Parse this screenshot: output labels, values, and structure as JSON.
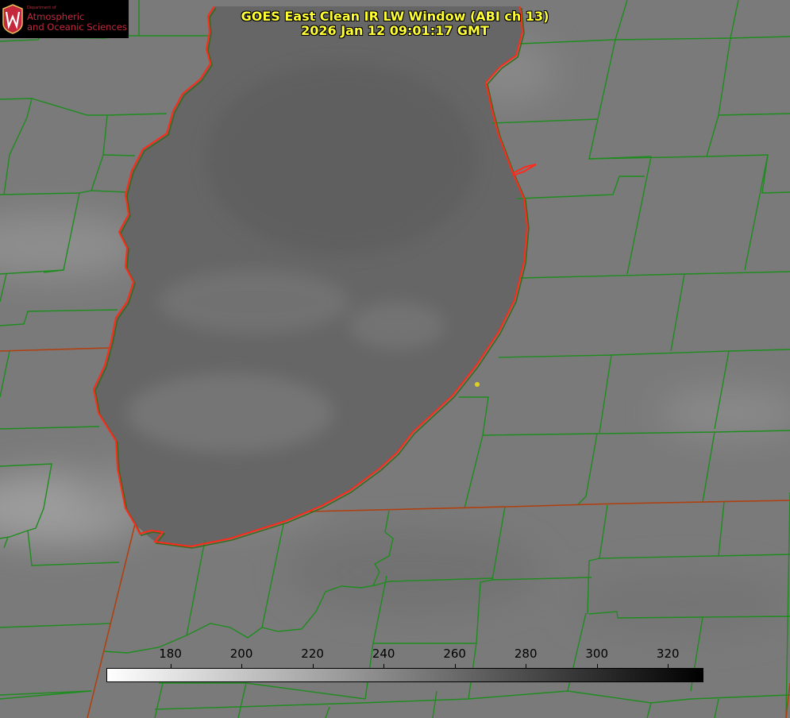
{
  "header": {
    "title_line1": "GOES East Clean IR LW Window (ABI ch 13)",
    "title_line2": "2026 Jan 12 09:01:17 GMT"
  },
  "logo": {
    "line1": "Department of",
    "line2": "Atmospheric",
    "line3": "and Oceanic Sciences",
    "seal_letter": "W",
    "color": "#c5283d"
  },
  "colorbar": {
    "ticks": [
      "180",
      "200",
      "220",
      "240",
      "260",
      "280",
      "300",
      "320"
    ],
    "tick_values": [
      180,
      200,
      220,
      240,
      260,
      280,
      300,
      320
    ],
    "range": [
      162,
      330
    ],
    "gradient": [
      "#ffffff",
      "#000000"
    ]
  },
  "map": {
    "colors": {
      "lake_shore": "#ff2a1a",
      "county_borders": "#1e8c1e",
      "state_borders": "#b04010",
      "marker": "#e0d020"
    }
  }
}
